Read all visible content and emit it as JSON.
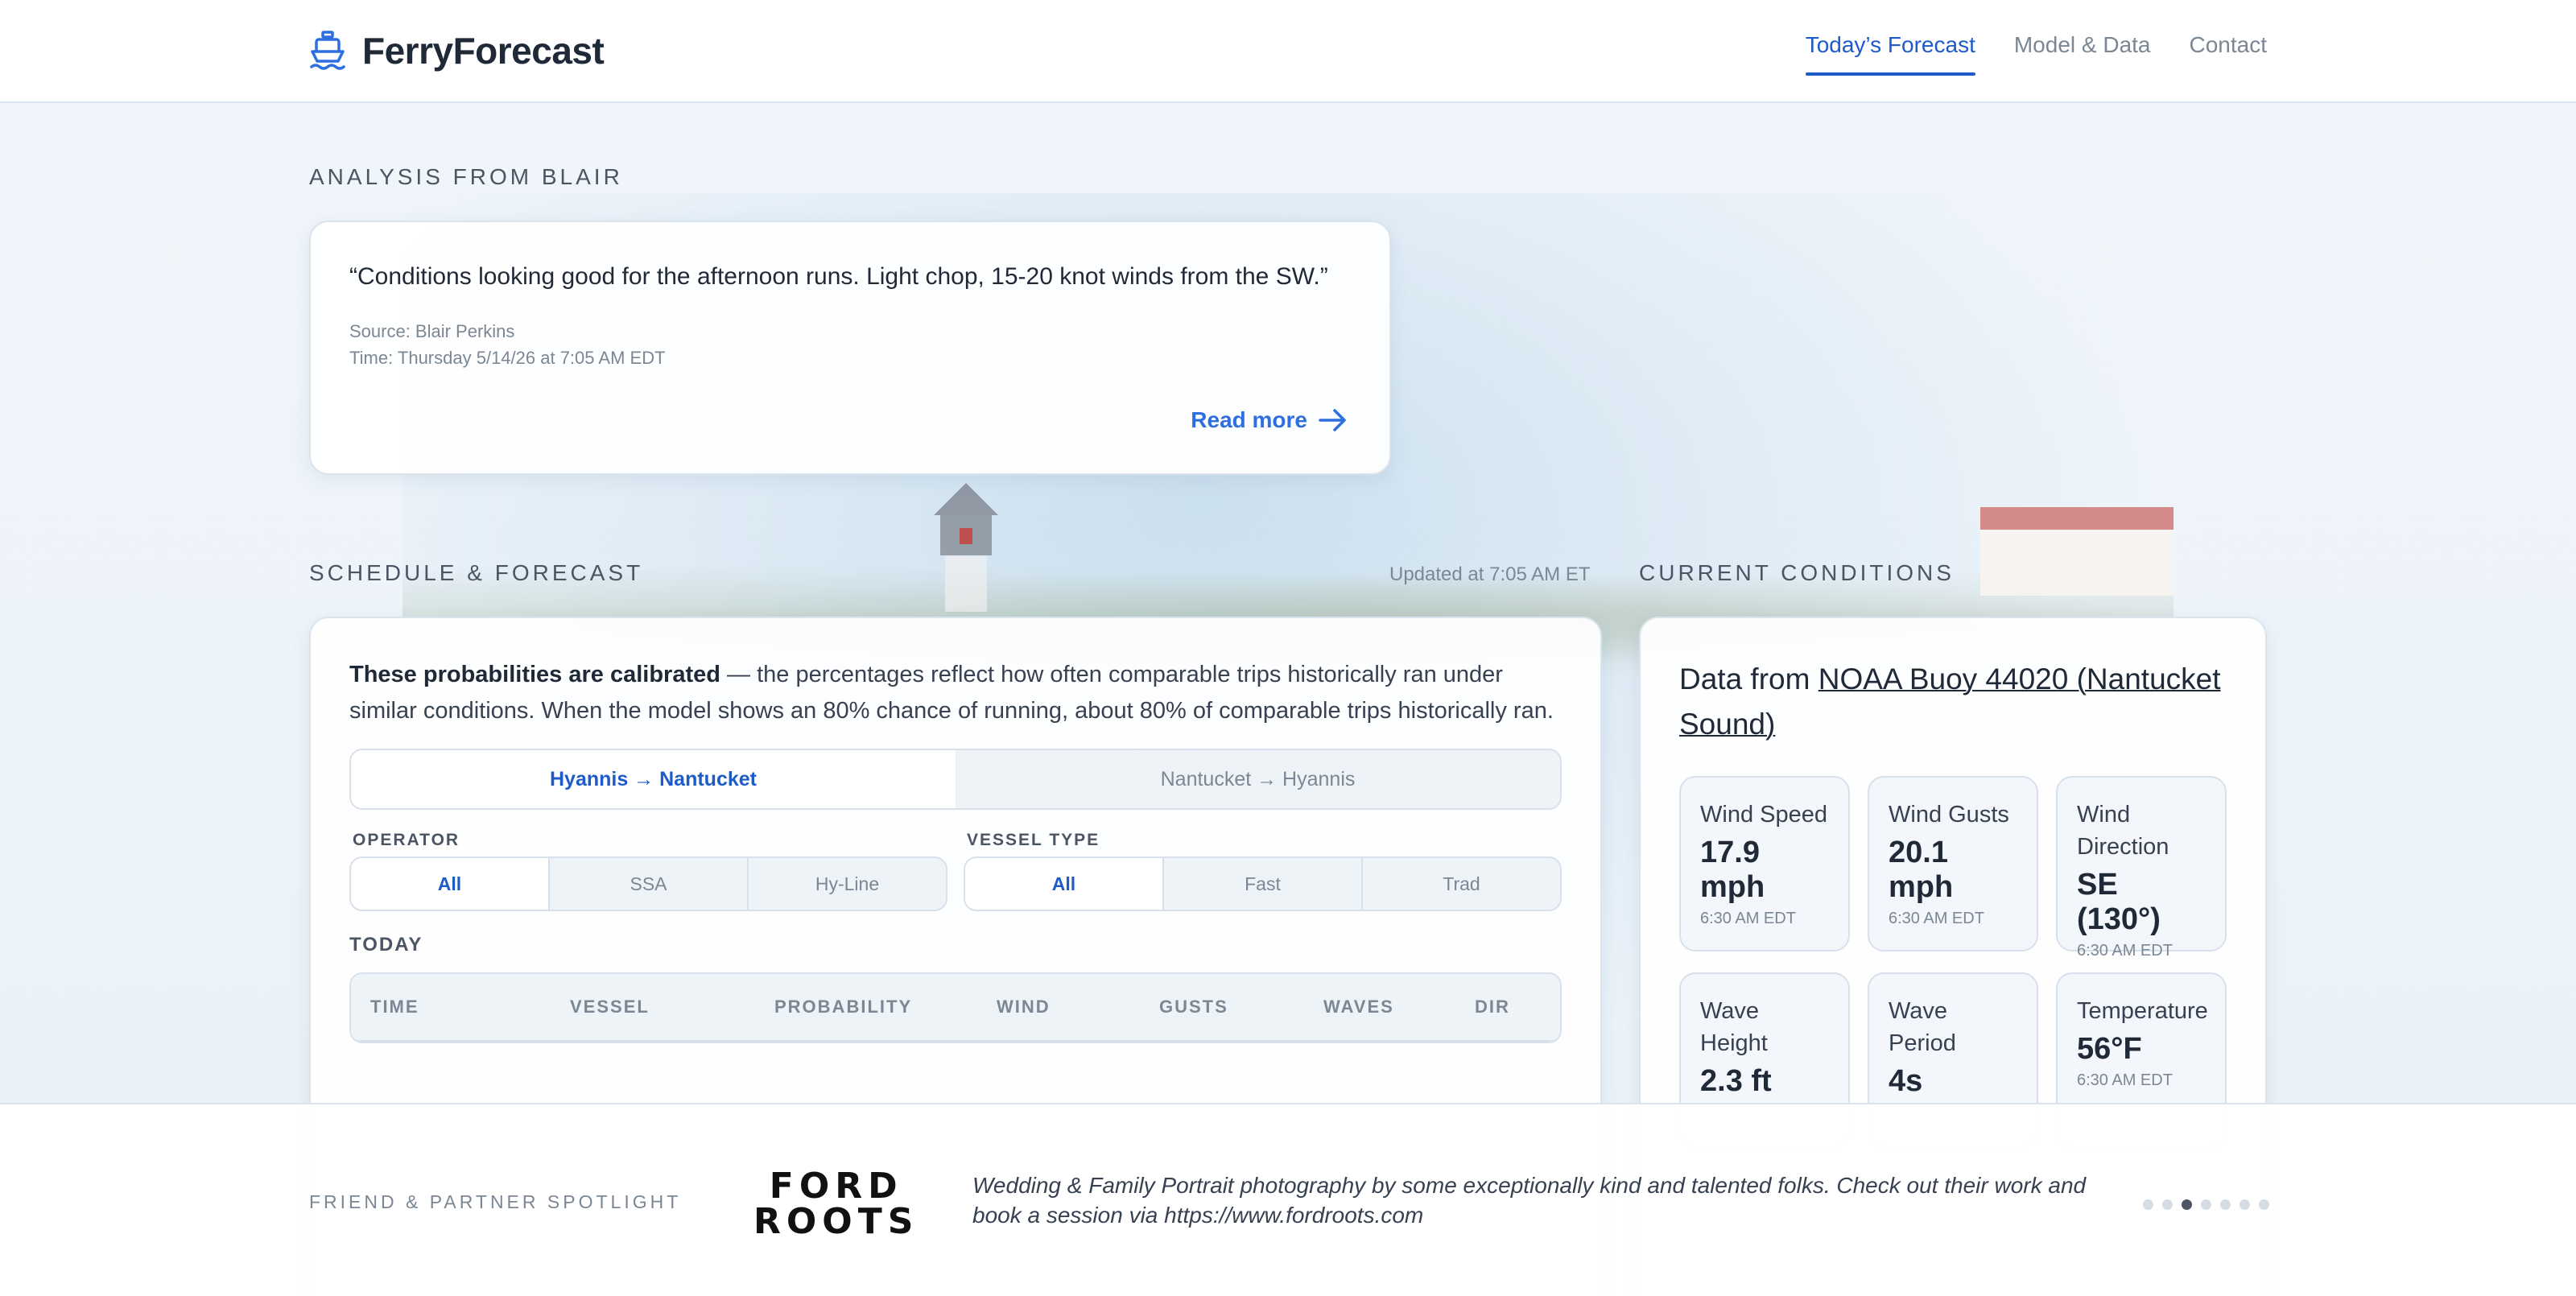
{
  "header": {
    "brand": "FerryForecast",
    "nav": [
      "Today’s Forecast",
      "Model & Data",
      "Contact"
    ]
  },
  "analysis": {
    "section_title": "ANALYSIS FROM BLAIR",
    "quote": "“Conditions looking good for the afternoon runs. Light chop, 15-20 knot winds from the SW.”",
    "source": "Source: Blair Perkins",
    "time": "Time: Thursday 5/14/26 at 7:05 AM EDT",
    "read_more": "Read more"
  },
  "schedule": {
    "section_title": "SCHEDULE & FORECAST",
    "updated": "Updated at 7:05 AM ET",
    "calibration_bold": "These probabilities are calibrated",
    "calibration_text": " — the percentages reflect how often comparable trips historically ran under similar conditions. When the model shows an 80% chance of running, about 80% of comparable trips historically ran.",
    "routes": [
      "Hyannis → Nantucket",
      "Nantucket → Hyannis"
    ],
    "operator_label": "OPERATOR",
    "operators": [
      "All",
      "SSA",
      "Hy-Line"
    ],
    "vessel_label": "VESSEL TYPE",
    "vessel_types": [
      "All",
      "Fast",
      "Trad"
    ],
    "today_label": "TODAY",
    "columns": [
      "TIME",
      "VESSEL",
      "PROBABILITY",
      "WIND",
      "GUSTS",
      "WAVES",
      "DIR"
    ]
  },
  "conditions": {
    "section_title": "CURRENT CONDITIONS",
    "data_from": "Data from ",
    "buoy_link": "NOAA Buoy 44020 (Nantucket Sound)",
    "tiles": [
      {
        "label": "Wind Speed",
        "value": "17.9 mph",
        "time": "6:30 AM EDT"
      },
      {
        "label": "Wind Gusts",
        "value": "20.1 mph",
        "time": "6:30 AM EDT"
      },
      {
        "label": "Wind Direction",
        "value": "SE (130°)",
        "time": "6:30 AM EDT"
      },
      {
        "label": "Wave Height",
        "value": "2.3 ft",
        "time": ""
      },
      {
        "label": "Wave Period",
        "value": "4s",
        "time": ""
      },
      {
        "label": "Temperature",
        "value": "56°F",
        "time": "6:30 AM EDT"
      }
    ]
  },
  "partner": {
    "label": "FRIEND & PARTNER SPOTLIGHT",
    "logo_line1": "FORD",
    "logo_line2": "ROOTS",
    "text": "Wedding & Family Portrait photography by some exceptionally kind and talented folks. Check out their work and book a session via https://www.fordroots.com",
    "dots": 7,
    "active_dot": 3
  },
  "colors": {
    "accent": "#1d5bc9",
    "link": "#2f6ee0",
    "muted": "#7b8794",
    "background": "#eef4fa"
  }
}
